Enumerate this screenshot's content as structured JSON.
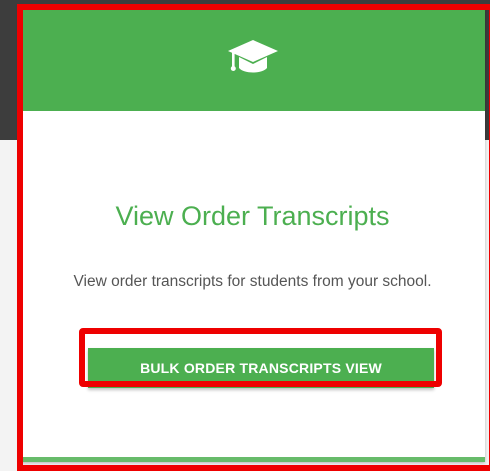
{
  "card": {
    "icon": "graduation-cap-icon",
    "title": "View Order Transcripts",
    "description": "View order transcripts for students from your school.",
    "button_label": "BULK ORDER TRANSCRIPTS VIEW"
  },
  "colors": {
    "accent": "#4caf50",
    "highlight": "#ee0000",
    "background_dark": "#3d3d3d",
    "background_light": "#f3f3f3",
    "card": "#ffffff",
    "description_text": "#555555"
  }
}
